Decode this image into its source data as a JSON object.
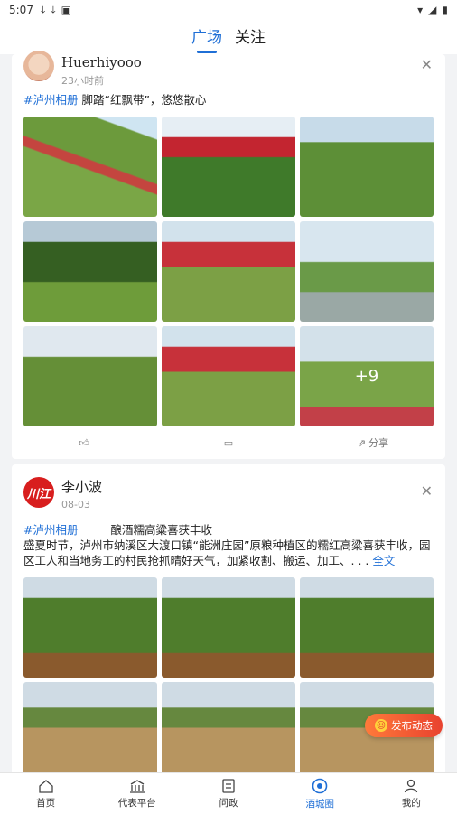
{
  "status": {
    "time": "5:07"
  },
  "tabs": [
    {
      "label": "广场"
    },
    {
      "label": "关注"
    }
  ],
  "posts": [
    {
      "author": "Huerhiyooo",
      "time": "23小时前",
      "tag": "#泸州相册",
      "text": "脚踏“红飘带”，悠悠散心",
      "more_count": "+9",
      "actions": {
        "share": "分享"
      }
    },
    {
      "author": "李小波",
      "time": "08-03",
      "avatar_text": "川江",
      "tag": "#泸州相册",
      "title": "酿酒糯高粱喜获丰收",
      "text": "盛夏时节，泸州市纳溪区大渡口镇“能洲庄园”原粮种植区的糯红高粱喜获丰收，园区工人和当地务工的村民抢抓晴好天气，加紧收割、搬运、加工、. . .",
      "full": "全文"
    }
  ],
  "fab": {
    "label": "发布动态"
  },
  "bottom_nav": [
    {
      "label": "首页"
    },
    {
      "label": "代表平台"
    },
    {
      "label": "问政"
    },
    {
      "label": "酒城圈"
    },
    {
      "label": "我的"
    }
  ],
  "colors": {
    "accent": "#1f6fd6",
    "fab": "#e8422f"
  }
}
